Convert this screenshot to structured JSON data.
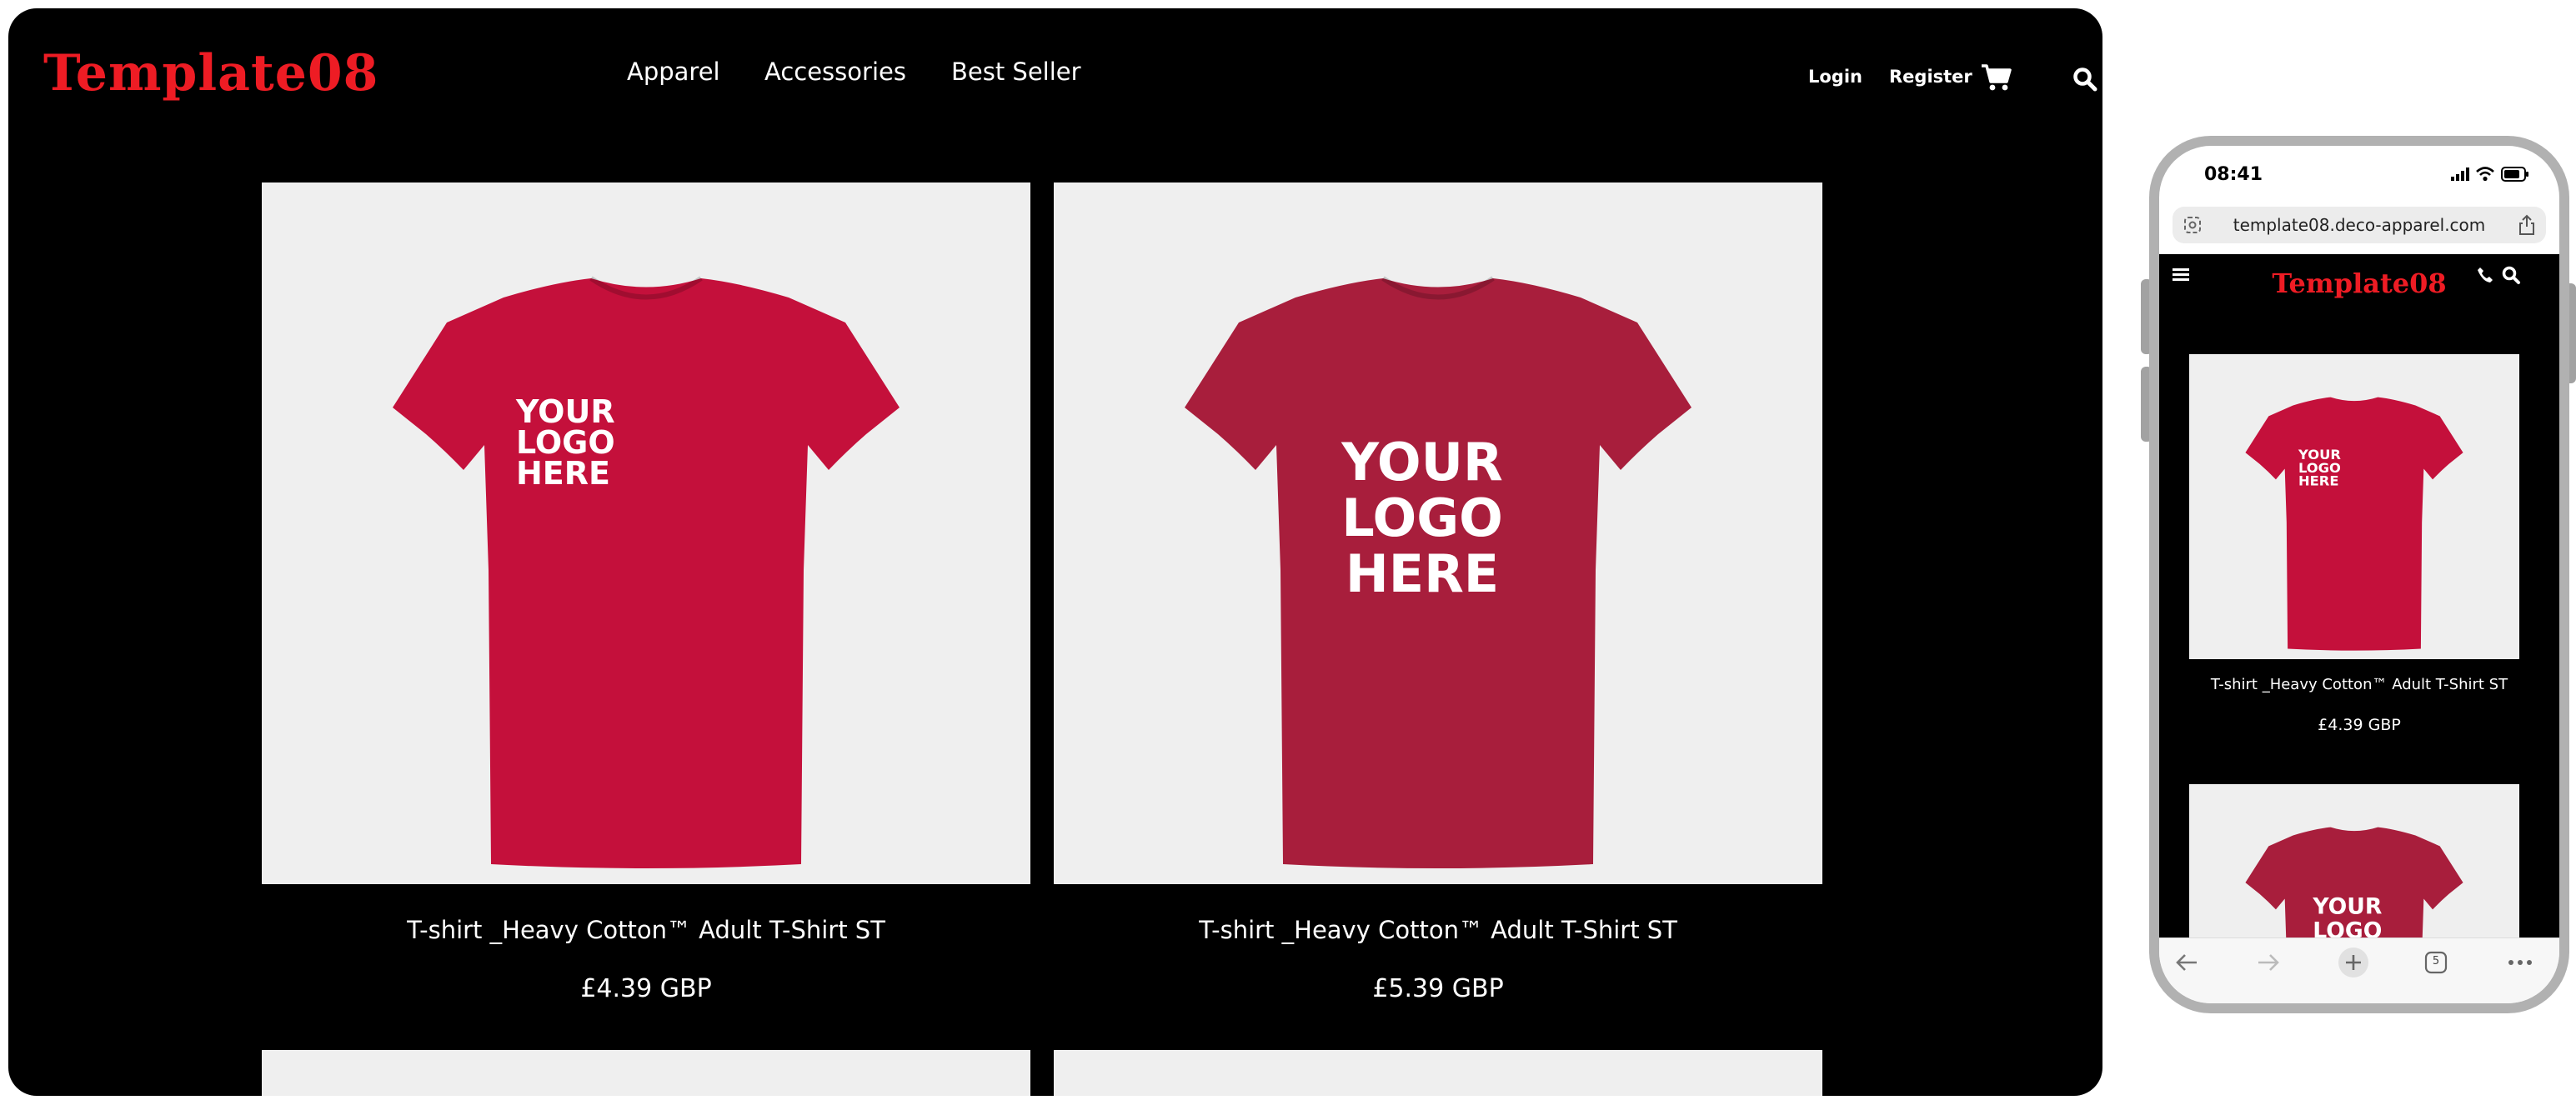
{
  "site": {
    "logo": "Template08",
    "brand_color": "#ee1c24"
  },
  "desktop": {
    "nav": [
      "Apparel",
      "Accessories",
      "Best Seller"
    ],
    "auth": {
      "login": "Login",
      "register": "Register"
    },
    "icons": [
      "cart-icon",
      "search-icon"
    ],
    "products": [
      {
        "title": "T-shirt _Heavy Cotton™ Adult T-Shirt ST",
        "price": "£4.39 GBP",
        "shirt_color": "#c4103b",
        "print": [
          "YOUR",
          "LOGO",
          "HERE"
        ]
      },
      {
        "title": "T-shirt _Heavy Cotton™ Adult T-Shirt ST",
        "price": "£5.39 GBP",
        "shirt_color": "#a81e3c",
        "print": [
          "YOUR",
          "LOGO",
          "HERE"
        ]
      }
    ]
  },
  "mobile": {
    "status_time": "08:41",
    "url": "template08.deco-apparel.com",
    "icons": [
      "menu-icon",
      "phone-icon",
      "search-icon"
    ],
    "products": [
      {
        "title": "T-shirt _Heavy Cotton™ Adult T-Shirt ST",
        "price": "£4.39 GBP"
      }
    ],
    "tab_count": "5"
  }
}
